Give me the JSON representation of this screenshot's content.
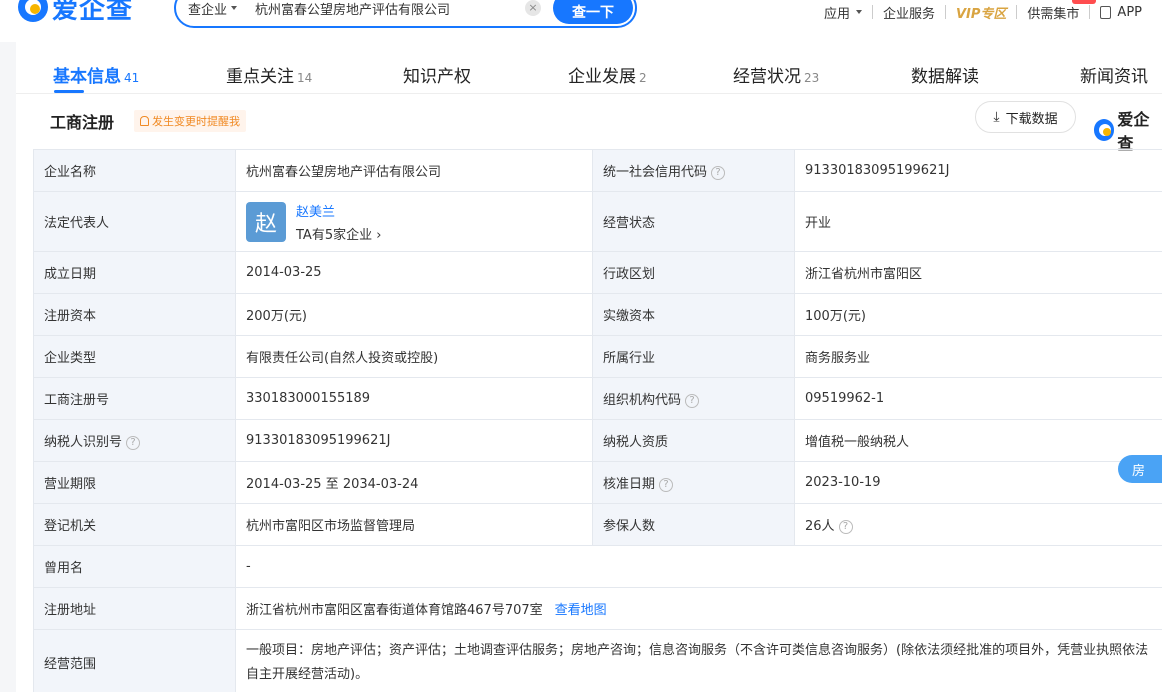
{
  "header": {
    "logo_text": "爱企查",
    "search_type": "查企业",
    "search_value": "杭州富春公望房地产评估有限公司",
    "search_button": "查一下",
    "nav": [
      "应用",
      "企业服务",
      "VIP专区",
      "供需集市",
      "APP"
    ]
  },
  "tabs": [
    {
      "label": "基本信息",
      "count": "41",
      "active": true
    },
    {
      "label": "重点关注",
      "count": "14"
    },
    {
      "label": "知识产权",
      "count": ""
    },
    {
      "label": "企业发展",
      "count": "2"
    },
    {
      "label": "经营状况",
      "count": "23"
    },
    {
      "label": "数据解读",
      "count": ""
    },
    {
      "label": "新闻资讯",
      "count": ""
    }
  ],
  "section": {
    "title": "工商注册",
    "remind": "发生变更时提醒我",
    "download": "下载数据",
    "brand": "爱企查"
  },
  "info": {
    "company_name_label": "企业名称",
    "company_name": "杭州富春公望房地产评估有限公司",
    "credit_code_label": "统一社会信用代码",
    "credit_code": "91330183095199621J",
    "legal_rep_label": "法定代表人",
    "legal_rep_avatar": "赵",
    "legal_rep_name": "赵美兰",
    "legal_rep_sub": "TA有5家企业",
    "status_label": "经营状态",
    "status": "开业",
    "found_date_label": "成立日期",
    "found_date": "2014-03-25",
    "region_label": "行政区划",
    "region": "浙江省杭州市富阳区",
    "reg_capital_label": "注册资本",
    "reg_capital": "200万(元)",
    "paid_capital_label": "实缴资本",
    "paid_capital": "100万(元)",
    "type_label": "企业类型",
    "type": "有限责任公司(自然人投资或控股)",
    "industry_label": "所属行业",
    "industry": "商务服务业",
    "reg_no_label": "工商注册号",
    "reg_no": "330183000155189",
    "org_code_label": "组织机构代码",
    "org_code": "09519962-1",
    "tax_id_label": "纳税人识别号",
    "tax_id": "91330183095199621J",
    "taxpayer_label": "纳税人资质",
    "taxpayer": "增值税一般纳税人",
    "period_label": "营业期限",
    "period": "2014-03-25 至 2034-03-24",
    "approve_label": "核准日期",
    "approve": "2023-10-19",
    "authority_label": "登记机关",
    "authority": "杭州市富阳区市场监督管理局",
    "insured_label": "参保人数",
    "insured": "26人",
    "former_name_label": "曾用名",
    "former_name": "-",
    "address_label": "注册地址",
    "address": "浙江省杭州市富阳区富春街道体育馆路467号707室",
    "map_link": "查看地图",
    "scope_label": "经营范围",
    "scope": "一般项目：房地产评估；资产评估；土地调查评估服务；房地产咨询；信息咨询服务（不含许可类信息咨询服务）(除依法须经批准的项目外，凭营业执照依法自主开展经营活动)。",
    "float_btn": "房"
  }
}
